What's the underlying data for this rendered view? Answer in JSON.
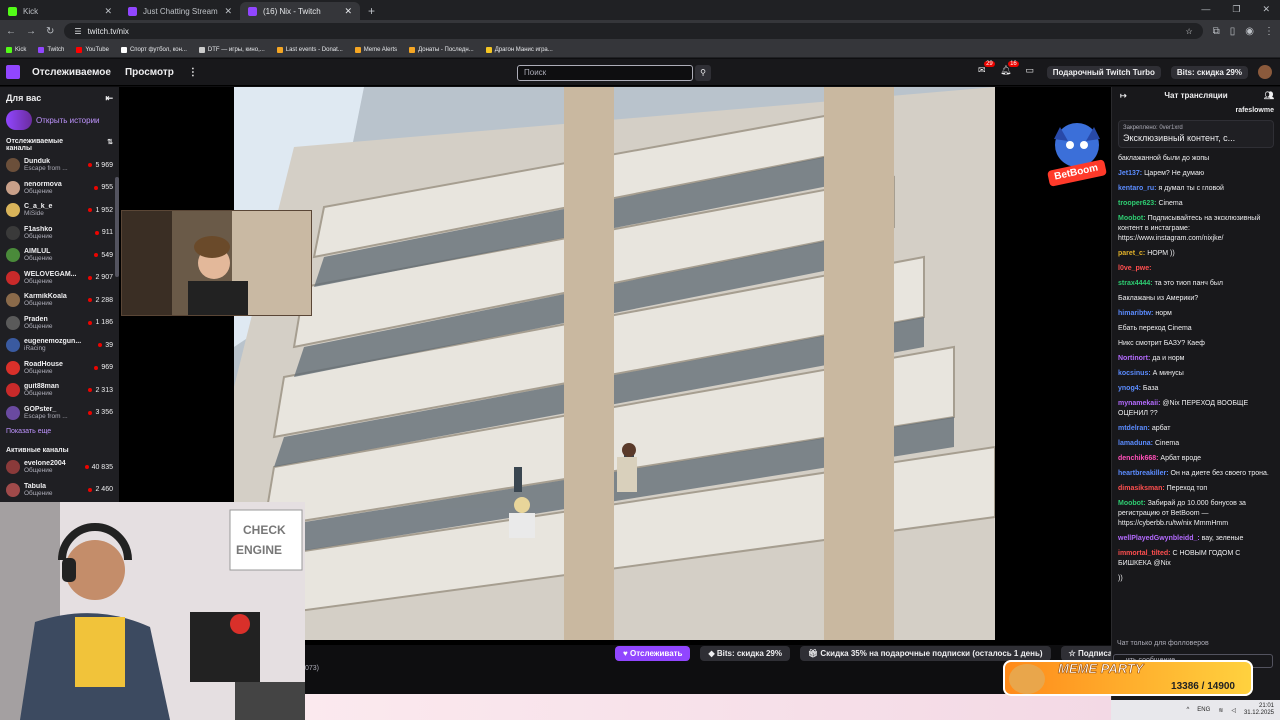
{
  "browser": {
    "tabs": [
      {
        "label": "Kick",
        "color": "#53fc18"
      },
      {
        "label": "Just Chatting Streaming - Live",
        "color": "#9146ff"
      },
      {
        "label": "(16) Nix - Twitch",
        "color": "#9146ff"
      }
    ],
    "url": "twitch.tv/nix",
    "bookmarks": [
      {
        "label": "Kick",
        "color": "#53fc18"
      },
      {
        "label": "Twitch",
        "color": "#9146ff"
      },
      {
        "label": "YouTube",
        "color": "#ff0000"
      },
      {
        "label": "Спорт футбол, кон...",
        "color": "#ffffff"
      },
      {
        "label": "DTF — игры, кино,...",
        "color": "#cccccc"
      },
      {
        "label": "Last events - Donat...",
        "color": "#f5a623"
      },
      {
        "label": "Meme Alerts",
        "color": "#f5a623"
      },
      {
        "label": "Донаты - Последн...",
        "color": "#f5a623"
      },
      {
        "label": "Драгон Манис игра...",
        "color": "#f5c623"
      }
    ]
  },
  "topnav": {
    "following": "Отслеживаемое",
    "browse": "Просмотр",
    "search_placeholder": "Поиск",
    "notif_count_1": "29",
    "notif_count_2": "16",
    "turbo": "Подарочный Twitch Turbo",
    "bits": "Bits: скидка 29%"
  },
  "sidebar": {
    "title": "Для вас",
    "stories": "Открыть истории",
    "followed_title": "Отслеживаемые каналы",
    "channels": [
      {
        "name": "Dunduk",
        "cat": "Escape from ...",
        "viewers": "5 969",
        "color": "#6b4f3a"
      },
      {
        "name": "nenormova",
        "cat": "Общение",
        "viewers": "955",
        "color": "#c9a089"
      },
      {
        "name": "C_a_k_e",
        "cat": "MiSide",
        "viewers": "1 952",
        "color": "#d9b45a"
      },
      {
        "name": "F1ashko",
        "cat": "Общение",
        "viewers": "911",
        "color": "#3a3a3a"
      },
      {
        "name": "AIMLUL",
        "cat": "Общение",
        "viewers": "549",
        "color": "#4a8a3a"
      },
      {
        "name": "WELOVEGAM...",
        "cat": "Общение",
        "viewers": "2 907",
        "color": "#c92a2a"
      },
      {
        "name": "KarmikKoala",
        "cat": "Общение",
        "viewers": "2 288",
        "color": "#8a6a4a"
      },
      {
        "name": "Praden",
        "cat": "Общение",
        "viewers": "1 186",
        "color": "#5a5a5a"
      },
      {
        "name": "eugenemozgun...",
        "cat": "iRacing",
        "viewers": "39",
        "color": "#3a5aa0"
      },
      {
        "name": "RoadHouse",
        "cat": "Общение",
        "viewers": "969",
        "color": "#d9302a"
      },
      {
        "name": "guit88man",
        "cat": "Общение",
        "viewers": "2 313",
        "color": "#c92a2a"
      },
      {
        "name": "GOPster_",
        "cat": "Escape from ...",
        "viewers": "3 356",
        "color": "#6a4aa0"
      }
    ],
    "show_more": "Показать еще",
    "active_title": "Активные каналы",
    "active": [
      {
        "name": "evelone2004",
        "cat": "Общение",
        "viewers": "40 835",
        "color": "#8a3a3a"
      },
      {
        "name": "Tabula",
        "cat": "Общение",
        "viewers": "2 460",
        "color": "#a04a4a"
      }
    ]
  },
  "player": {
    "follow": "Отслеживать",
    "bits_offer": "Bits: скидка 29%",
    "gift_offer": "Скидка 35% на подарочные подписки (осталось 1 день)",
    "subscribe": "Подписаться",
    "sponsor": "BetBoom",
    "partial_text": "073)"
  },
  "chat": {
    "title": "Чат трансляции",
    "gifter": "rafeslowme",
    "pinned_by": "Закреплено: 0ver1xrd",
    "pinned_text": "Эксклюзивный контент, с...",
    "messages": [
      {
        "user": "",
        "text": "баклажанной были до жопы",
        "color": "#efeff1"
      },
      {
        "user": "Jet137:",
        "text": "Царем? Не думаю",
        "color": "#5b8cff"
      },
      {
        "user": "kentaro_ru:",
        "text": "я думал ты с гловой",
        "color": "#5b8cff"
      },
      {
        "user": "trooper623:",
        "text": "Cinema",
        "color": "#2ecc71"
      },
      {
        "user": "Moobot:",
        "text": "Подписывайтесь на эксклюзивный контент в инстаграме: https://www.instagram.com/nixjke/",
        "color": "#2ecc71"
      },
      {
        "user": "paret_c:",
        "text": "НОРМ ))",
        "color": "#e0b02a"
      },
      {
        "user": "l0ve_pwe:",
        "text": "",
        "color": "#ff4f4f"
      },
      {
        "user": "strax4444:",
        "text": "та это тиоп панч был",
        "color": "#2ecc71"
      },
      {
        "user": "",
        "text": "Баклажаны из Америки?",
        "color": "#efeff1"
      },
      {
        "user": "himaribtw:",
        "text": "норм",
        "color": "#5b8cff"
      },
      {
        "user": "",
        "text": "Ебать переход Cinema",
        "color": "#efeff1"
      },
      {
        "user": "",
        "text": "Никс смотрит БАЗУ? Каеф",
        "color": "#efeff1"
      },
      {
        "user": "Nortinort:",
        "text": "да и норм",
        "color": "#b46bff"
      },
      {
        "user": "kocsinus:",
        "text": "А минусы",
        "color": "#5b8cff"
      },
      {
        "user": "ynog4:",
        "text": "База",
        "color": "#5b8cff"
      },
      {
        "user": "mynamekaii:",
        "text": "@Nix ПЕРЕХОД ВООБЩЕ ОЦЕНИЛ ??",
        "color": "#b46bff"
      },
      {
        "user": "mtdelran:",
        "text": "арбат",
        "color": "#5b8cff"
      },
      {
        "user": "lamaduna:",
        "text": "Cinema",
        "color": "#5b8cff"
      },
      {
        "user": "denchik668:",
        "text": "Арбат вроде",
        "color": "#ff4fb8"
      },
      {
        "user": "heartbreakiller:",
        "text": "Он на диете без своего трона.",
        "color": "#5b8cff"
      },
      {
        "user": "dimasiksman:",
        "text": "Переход топ",
        "color": "#ff4f4f"
      },
      {
        "user": "Moobot:",
        "text": "Забирай до 10.000 бонусов за регистрацию от BetBoom — https://cyberbb.ru/tw/nix MmmHmm",
        "color": "#2ecc71"
      },
      {
        "user": "wellPlayedGwynbleidd_:",
        "text": "вау, зеленые",
        "color": "#b46bff"
      },
      {
        "user": "immortal_tilted:",
        "text": "С НОВЫМ ГОДОМ С БИШКЕКА @Nix",
        "color": "#ff4f4f"
      },
      {
        "user": "",
        "text": "))",
        "color": "#efeff1"
      }
    ],
    "followers_only": "Чат только для фолловеров",
    "input_placeholder": "...ить сообщение"
  },
  "meme": {
    "title": "MEME PARTY",
    "progress": "13386 / 14900"
  },
  "taskbar": {
    "lang": "ENG",
    "time": "21:01",
    "date": "31.12.2025"
  }
}
